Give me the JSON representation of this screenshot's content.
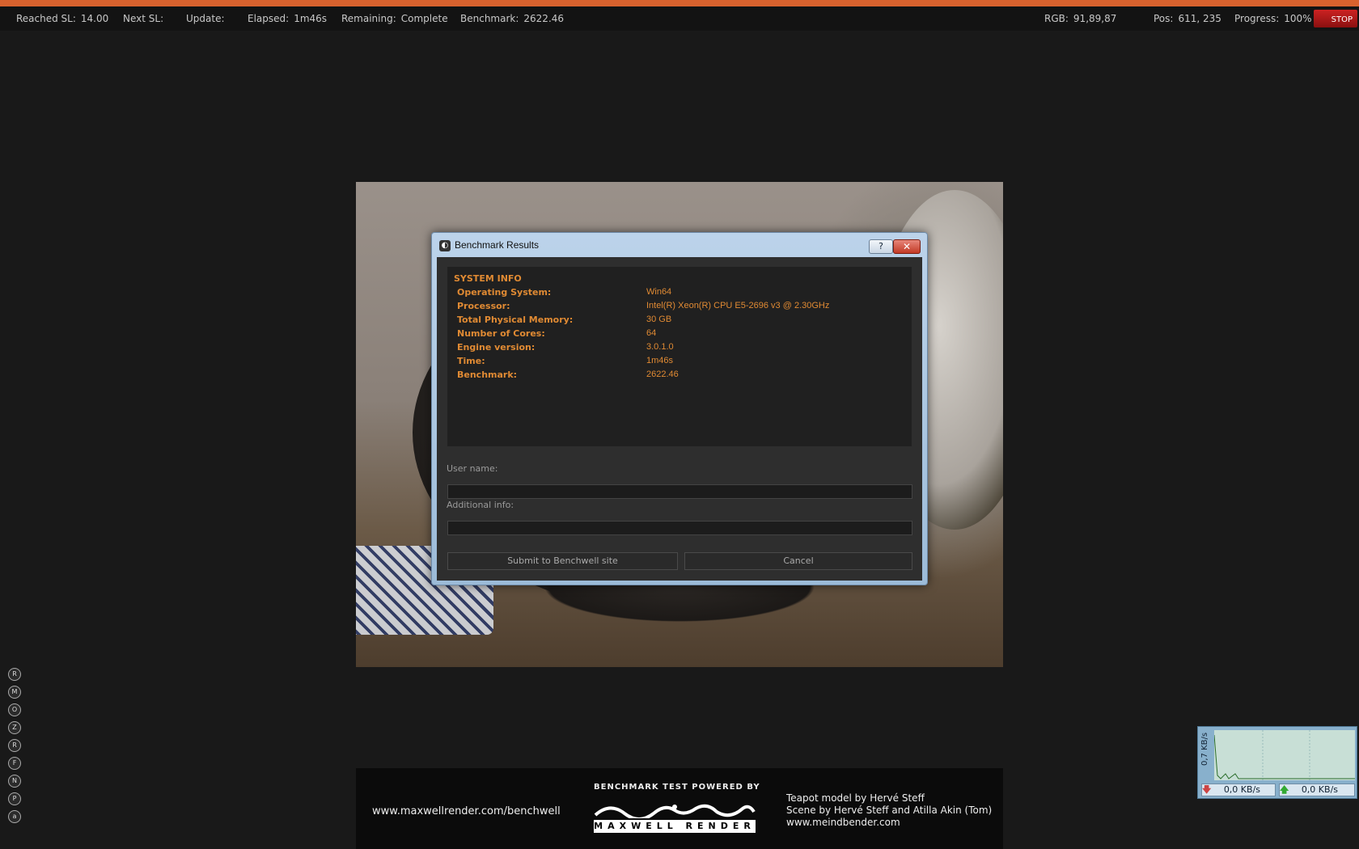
{
  "status": {
    "reached_sl_label": "Reached SL:",
    "reached_sl": "14.00",
    "next_sl_label": "Next SL:",
    "next_sl": "",
    "update_label": "Update:",
    "update": "",
    "elapsed_label": "Elapsed:",
    "elapsed": "1m46s",
    "remaining_label": "Remaining:",
    "remaining": "Complete",
    "benchmark_label": "Benchmark:",
    "benchmark": "2622.46",
    "rgb_label": "RGB:",
    "rgb": "91,89,87",
    "pos_label": "Pos:",
    "pos": "611, 235",
    "progress_label": "Progress:",
    "progress": "100%",
    "stop_label": "STOP"
  },
  "dialog": {
    "title": "Benchmark Results",
    "help_label": "?",
    "close_label": "✕",
    "section_title": "SYSTEM INFO",
    "rows": [
      {
        "key": "Operating System:",
        "value": "Win64"
      },
      {
        "key": "Processor:",
        "value": "Intel(R) Xeon(R) CPU E5-2696 v3 @ 2.30GHz"
      },
      {
        "key": "Total Physical Memory:",
        "value": "30 GB"
      },
      {
        "key": "Number of Cores:",
        "value": "64"
      },
      {
        "key": "Engine version:",
        "value": "3.0.1.0"
      },
      {
        "key": "Time:",
        "value": "1m46s"
      },
      {
        "key": "Benchmark:",
        "value": "2622.46"
      }
    ],
    "user_name_label": "User name:",
    "user_name_value": "",
    "additional_info_label": "Additional info:",
    "additional_info_value": "",
    "submit_label": "Submit to Benchwell site",
    "cancel_label": "Cancel"
  },
  "credits": {
    "url": "www.maxwellrender.com/benchwell",
    "powered_by": "BENCHMARK TEST POWERED BY",
    "logo_text": "MAXWELL RENDER",
    "line1": "Teapot model by Hervé Steff",
    "line2": "Scene by Hervé Steff and Atilla Akin (Tom)",
    "line3": "www.meindbender.com"
  },
  "side_icons": [
    "R",
    "M",
    "O",
    "Z",
    "R",
    "F",
    "N",
    "P",
    "a"
  ],
  "network": {
    "axis_label": "0,7 KB/s",
    "down": "0,0 KB/s",
    "up": "0,0 KB/s"
  }
}
